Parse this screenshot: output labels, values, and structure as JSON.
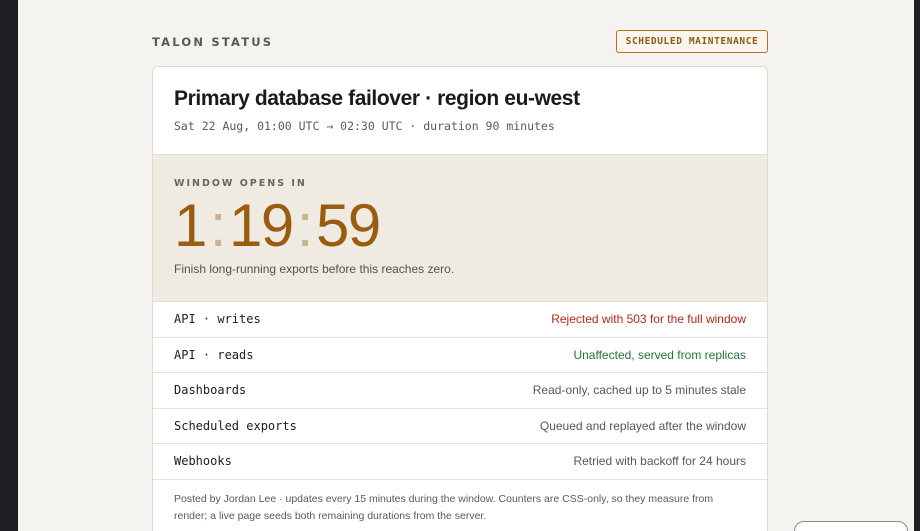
{
  "brand": "TALON STATUS",
  "badge": "SCHEDULED MAINTENANCE",
  "event": {
    "title": "Primary database failover · region eu-west",
    "schedule": "Sat 22 Aug, 01:00 UTC → 02:30 UTC · duration 90 minutes"
  },
  "countdown": {
    "label": "WINDOW OPENS IN",
    "hours": "1",
    "minutes": "19",
    "seconds": "59",
    "separator": ":",
    "note": "Finish long-running exports before this reaches zero."
  },
  "impacts": [
    {
      "service": "API · writes",
      "effect": "Rejected with 503 for the full window",
      "status": "bad"
    },
    {
      "service": "API · reads",
      "effect": "Unaffected, served from replicas",
      "status": "good"
    },
    {
      "service": "Dashboards",
      "effect": "Read-only, cached up to 5 minutes stale",
      "status": "neutral"
    },
    {
      "service": "Scheduled exports",
      "effect": "Queued and replayed after the window",
      "status": "neutral"
    },
    {
      "service": "Webhooks",
      "effect": "Retried with backoff for 24 hours",
      "status": "neutral"
    }
  ],
  "footer": "Posted by Jordan Lee · updates every 15 minutes during the window. Counters are CSS-only, so they measure from render; a live page seeds both remaining durations from the server.",
  "colors": {
    "accent": "#9a5d0f",
    "bad": "#b3261e",
    "good": "#23733a"
  }
}
